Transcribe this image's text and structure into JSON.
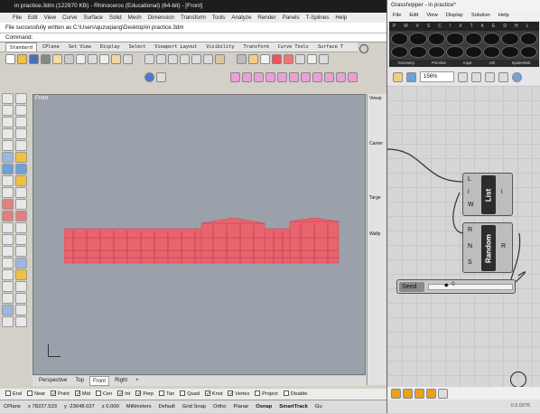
{
  "rhino": {
    "title": "in practice.3dm (122970 KB) - Rhinoceros (Educational) (64-bit) - [Front]",
    "menu": [
      "File",
      "Edit",
      "View",
      "Curve",
      "Surface",
      "Solid",
      "Mesh",
      "Dimension",
      "Transform",
      "Tools",
      "Analyze",
      "Render",
      "Panels",
      "T-Splines",
      "Help"
    ],
    "history": "File successfully written as C:\\Users\\quzuqiang\\Desktop\\in practice.3dm",
    "command_label": "Command:",
    "tabs": [
      "Standard",
      "CPlane",
      "Set View",
      "Display",
      "Select",
      "Viewport Layout",
      "Visibility",
      "Transform",
      "Curve Tools",
      "Surface T"
    ],
    "viewport_label": "Front",
    "viewport_tabs": [
      "Perspective",
      "Top",
      "Front",
      "Right"
    ],
    "active_viewport_tab": "Front",
    "props_lines": [
      "Viewp",
      "Camer",
      "Targe",
      "Wallp"
    ],
    "osnaps": [
      {
        "label": "End",
        "checked": false
      },
      {
        "label": "Near",
        "checked": false
      },
      {
        "label": "Point",
        "checked": true
      },
      {
        "label": "Mid",
        "checked": true
      },
      {
        "label": "Cen",
        "checked": false
      },
      {
        "label": "Int",
        "checked": true
      },
      {
        "label": "Perp",
        "checked": true
      },
      {
        "label": "Tan",
        "checked": false
      },
      {
        "label": "Quad",
        "checked": false
      },
      {
        "label": "Knot",
        "checked": true
      },
      {
        "label": "Vertex",
        "checked": true
      },
      {
        "label": "Project",
        "checked": false
      },
      {
        "label": "Disable",
        "checked": false
      }
    ],
    "status": {
      "cplane": "CPlane",
      "x": "x 78227.533",
      "y": "y -23648.027",
      "z": "z 0.000",
      "units": "Millimeters",
      "layer": "Default",
      "toggles": [
        "Grid Snap",
        "Ortho",
        "Planar",
        "Osnap",
        "SmartTrack",
        "Gu"
      ]
    }
  },
  "grasshopper": {
    "title": "Grasshopper - in practice*",
    "menu": [
      "File",
      "Edit",
      "View",
      "Display",
      "Solution",
      "Help"
    ],
    "tabs": [
      "P",
      "M",
      "V",
      "S",
      "C",
      "I",
      "X",
      "T",
      "K",
      "E",
      "D",
      "H",
      "L"
    ],
    "categories": [
      "Geometry",
      "Primitive",
      "Input",
      "Util",
      "SpiderWeb"
    ],
    "zoom": "156%",
    "components": {
      "list": {
        "name": "List",
        "inputs": [
          "L",
          "i",
          "W"
        ],
        "outputs": [
          "i"
        ]
      },
      "random": {
        "name": "Random",
        "inputs": [
          "R",
          "N",
          "S"
        ],
        "outputs": [
          "R"
        ]
      },
      "seed": {
        "label": "Seed",
        "value": "6"
      }
    },
    "version": "0.9.0076"
  }
}
